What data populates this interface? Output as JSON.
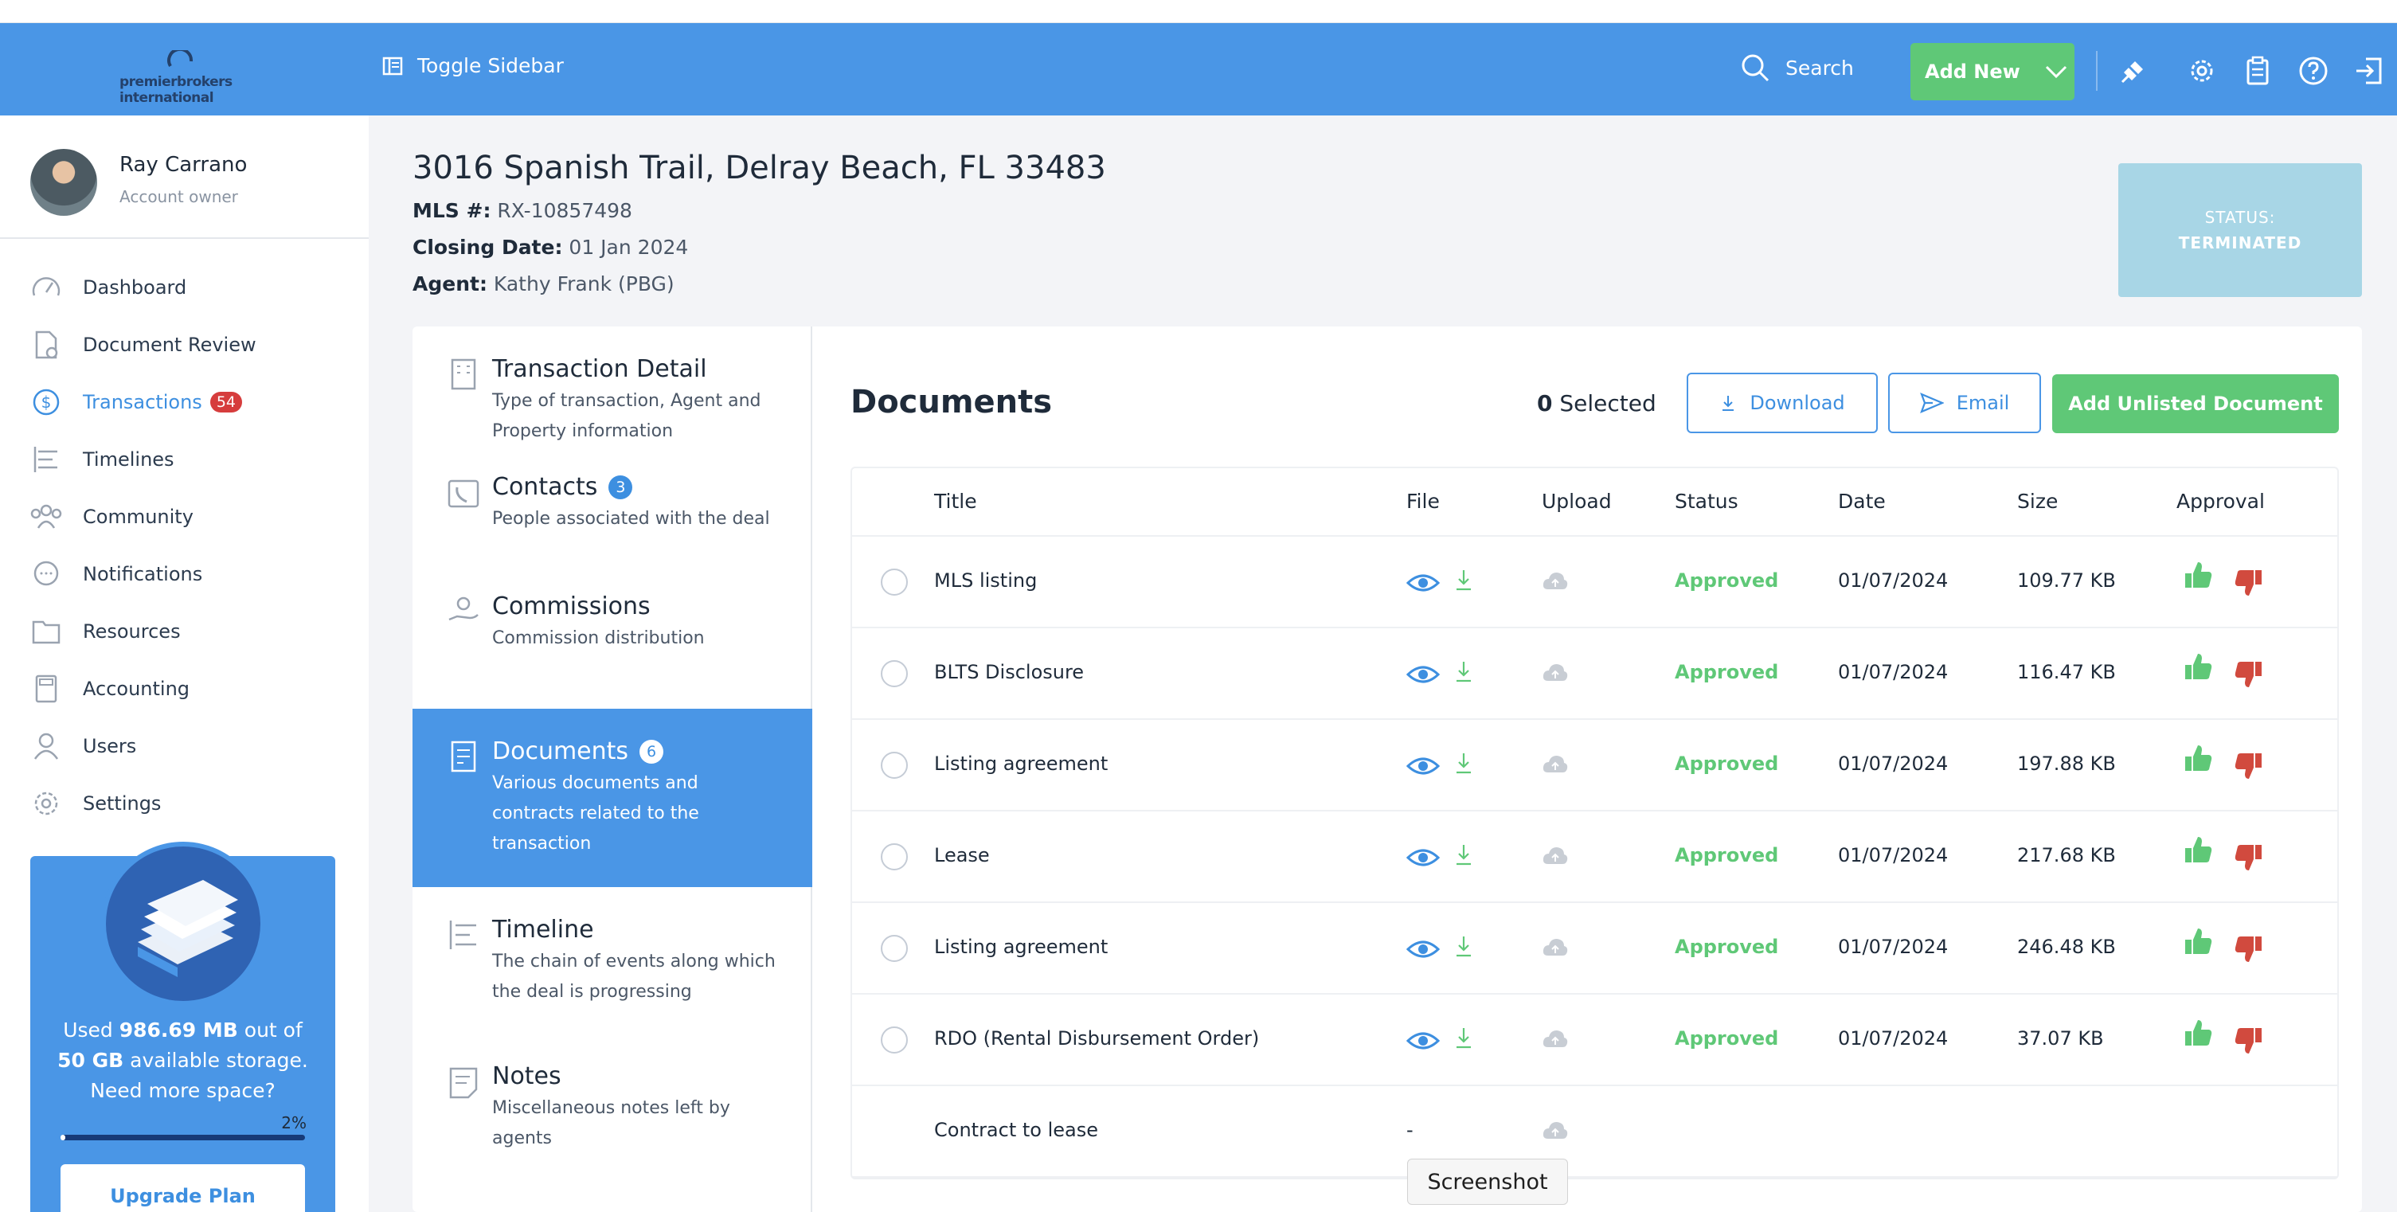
{
  "header": {
    "logo_text": "premierbrokers international",
    "toggle_label": "Toggle Sidebar",
    "search_label": "Search",
    "add_new_label": "Add New"
  },
  "user": {
    "name": "Ray Carrano",
    "role": "Account owner"
  },
  "sidebar": {
    "items": [
      {
        "label": "Dashboard"
      },
      {
        "label": "Document Review"
      },
      {
        "label": "Transactions",
        "badge": "54"
      },
      {
        "label": "Timelines"
      },
      {
        "label": "Community"
      },
      {
        "label": "Notifications"
      },
      {
        "label": "Resources"
      },
      {
        "label": "Accounting"
      },
      {
        "label": "Users"
      },
      {
        "label": "Settings"
      }
    ]
  },
  "storage": {
    "prefix": "Used",
    "used": "986.69 MB",
    "mid": "out of",
    "total": "50 GB",
    "suffix": "available storage.",
    "line3": "Need more space?",
    "percent_label": "2%",
    "percent": 2,
    "upgrade_label": "Upgrade Plan"
  },
  "transaction": {
    "address": "3016 Spanish Trail, Delray Beach, FL 33483",
    "mls_label": "MLS #:",
    "mls": "RX-10857498",
    "closing_label": "Closing Date:",
    "closing": "01 Jan 2024",
    "agent_label": "Agent:",
    "agent": "Kathy Frank (PBG)",
    "status_label": "STATUS:",
    "status": "TERMINATED"
  },
  "tabs": [
    {
      "title": "Transaction Detail",
      "desc1": "Type of transaction, Agent and",
      "desc2": "Property information"
    },
    {
      "title": "Contacts",
      "badge": "3",
      "desc1": "People associated with the deal"
    },
    {
      "title": "Commissions",
      "desc1": "Commission distribution"
    },
    {
      "title": "Documents",
      "badge": "6",
      "desc1": "Various documents and",
      "desc2": "contracts related to the",
      "desc3": "transaction"
    },
    {
      "title": "Timeline",
      "desc1": "The chain of events along which",
      "desc2": "the deal is progressing"
    },
    {
      "title": "Notes",
      "desc1": "Miscellaneous notes left by",
      "desc2": "agents"
    }
  ],
  "documents": {
    "title": "Documents",
    "selected_count": "0",
    "selected_label": "Selected",
    "download_label": "Download",
    "email_label": "Email",
    "add_unlisted_label": "Add Unlisted Document",
    "columns": [
      "Title",
      "File",
      "Upload",
      "Status",
      "Date",
      "Size",
      "Approval"
    ],
    "rows": [
      {
        "title": "MLS listing",
        "status": "Approved",
        "date": "01/07/2024",
        "size": "109.77 KB"
      },
      {
        "title": "BLTS Disclosure",
        "status": "Approved",
        "date": "01/07/2024",
        "size": "116.47 KB"
      },
      {
        "title": "Listing agreement",
        "status": "Approved",
        "date": "01/07/2024",
        "size": "197.88 KB"
      },
      {
        "title": "Lease",
        "status": "Approved",
        "date": "01/07/2024",
        "size": "217.68 KB"
      },
      {
        "title": "Listing agreement",
        "status": "Approved",
        "date": "01/07/2024",
        "size": "246.48 KB"
      },
      {
        "title": "RDO (Rental Disbursement Order)",
        "status": "Approved",
        "date": "01/07/2024",
        "size": "37.07 KB"
      }
    ],
    "pending_row": {
      "title": "Contract to lease",
      "file": "-"
    }
  },
  "tooltip": "Screenshot",
  "colors": {
    "primary": "#4a96e6",
    "green": "#5fc877",
    "red": "#d14a3e",
    "badge_red": "#d63d3d"
  }
}
